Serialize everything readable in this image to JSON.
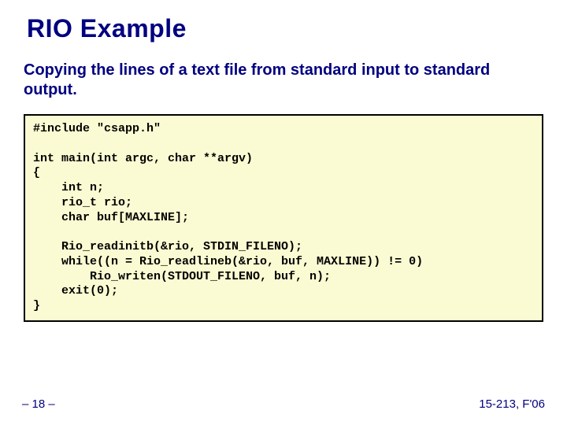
{
  "title": "RIO Example",
  "subtitle": "Copying the lines of a text file from standard input to standard output.",
  "code": "#include \"csapp.h\"\n\nint main(int argc, char **argv)\n{\n    int n;\n    rio_t rio;\n    char buf[MAXLINE];\n\n    Rio_readinitb(&rio, STDIN_FILENO);\n    while((n = Rio_readlineb(&rio, buf, MAXLINE)) != 0)\n        Rio_writen(STDOUT_FILENO, buf, n);\n    exit(0);\n}",
  "footer": {
    "left": "– 18 –",
    "right": "15-213, F'06"
  }
}
